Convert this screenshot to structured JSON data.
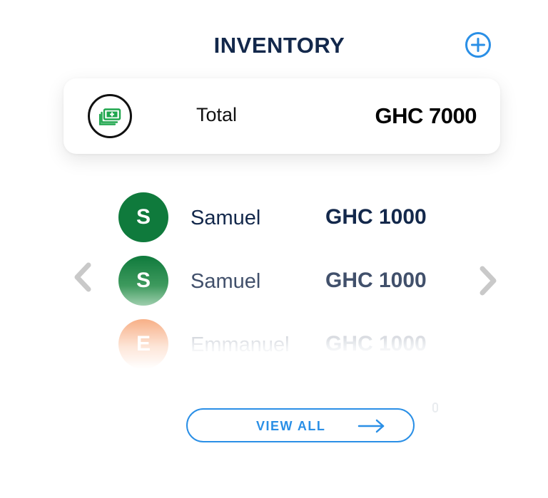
{
  "header": {
    "title": "INVENTORY",
    "add_icon": "plus-circle-icon",
    "accent_color": "#2a8fe6"
  },
  "total_card": {
    "icon": "money-icon",
    "label": "Total",
    "amount": "GHC 7000"
  },
  "list": {
    "items": [
      {
        "initial": "S",
        "name": "Samuel",
        "amount": "GHC 1000",
        "avatar_color": "#0f7a3c"
      },
      {
        "initial": "S",
        "name": "Samuel",
        "amount": "GHC 1000",
        "avatar_color": "#0f7a3c"
      },
      {
        "initial": "E",
        "name": "Emmanuel",
        "amount": "GHC 1000",
        "avatar_color": "#f7a77a"
      }
    ],
    "prev_icon": "chevron-left-icon",
    "next_icon": "chevron-right-icon"
  },
  "footer": {
    "view_all_label": "VIEW ALL",
    "arrow_icon": "arrow-right-icon"
  }
}
